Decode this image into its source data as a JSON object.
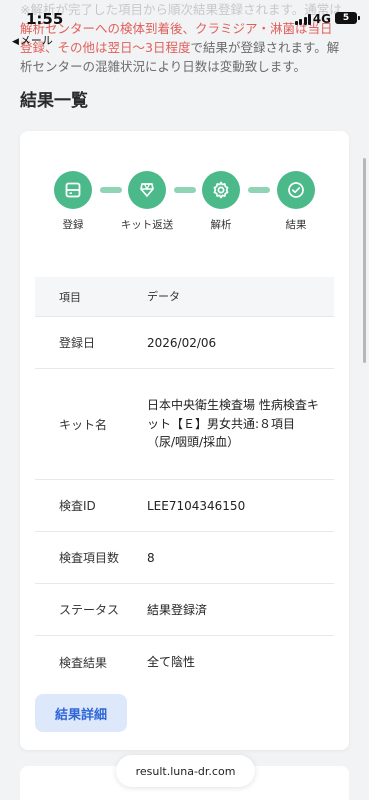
{
  "status": {
    "time": "1:55",
    "back_label": "メール",
    "network": "4G",
    "battery": "5"
  },
  "notice": {
    "line1": "※解析が完了した項目から順次結果登録されます。通常は",
    "part_a": "解析センターへの検体到着後、クラミジア・淋菌は当日",
    "part_b": "登録、その他は翌日〜3日程度",
    "part_c": "で結果が登録されます。解",
    "line4": "析センターの混雑状況により日数は変動致します。"
  },
  "section_title": "結果一覧",
  "steps": [
    {
      "label": "登録",
      "icon": "register-icon"
    },
    {
      "label": "キット返送",
      "icon": "kit-return-icon"
    },
    {
      "label": "解析",
      "icon": "analysis-gear-icon"
    },
    {
      "label": "結果",
      "icon": "result-check-icon"
    }
  ],
  "colors": {
    "step_active": "#4cb98a",
    "step_line": "#8fd5b5",
    "notice_red": "#e0605a",
    "button_bg": "#dde8fb",
    "button_text": "#2f66d6"
  },
  "table": {
    "header": {
      "key": "項目",
      "value": "データ"
    },
    "rows": [
      {
        "key": "登録日",
        "value": "2026/02/06"
      },
      {
        "key": "キット名",
        "value": "日本中央衛生検査場 性病検査キット【Ｅ】男女共通:８項目（尿/咽頭/採血）"
      },
      {
        "key": "検査ID",
        "value": "LEE7104346150"
      },
      {
        "key": "検査項目数",
        "value": "8"
      },
      {
        "key": "ステータス",
        "value": "結果登録済"
      },
      {
        "key": "検査結果",
        "value": "全て陰性"
      }
    ]
  },
  "detail_button": "結果詳細",
  "url": "result.luna-dr.com"
}
